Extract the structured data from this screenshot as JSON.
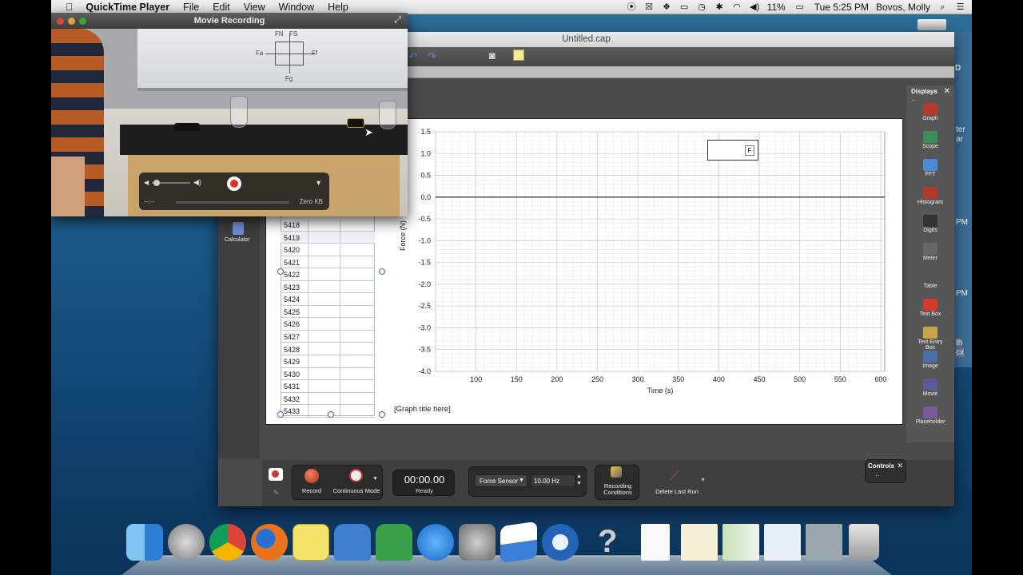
{
  "menubar": {
    "apple": "",
    "app_name": "QuickTime Player",
    "items": [
      "File",
      "Edit",
      "View",
      "Window",
      "Help"
    ],
    "battery": "11%",
    "clock": "Tue 5:25 PM",
    "user": "Bovos, Molly"
  },
  "quicktime": {
    "title": "Movie Recording",
    "elapsed": "--:--",
    "size": "Zero KB",
    "whiteboard": [
      "FN",
      "FS",
      "Fa",
      "Ff",
      "Fg"
    ]
  },
  "logger": {
    "window_title": "Untitled.cap",
    "calculator_label": "Calculator",
    "table_rows": [
      "5418",
      "5419",
      "5420",
      "5421",
      "5422",
      "5423",
      "5424",
      "5425",
      "5426",
      "5427",
      "5428",
      "5429",
      "5430",
      "5431",
      "5432",
      "5433"
    ],
    "graph_title": "[Graph title here]",
    "legend_label": "F",
    "displays": {
      "header": "Displays",
      "items": [
        "Graph",
        "Scope",
        "FFT",
        "Histogram",
        "Digits",
        "Meter",
        "Table",
        "Text Box",
        "Text Entry Box",
        "Image",
        "Movie",
        "Placeholder"
      ]
    },
    "controls": {
      "panel_label": "Controls",
      "record": "Record",
      "mode": "Continuous Mode",
      "time": "00:00.00",
      "status": "Ready",
      "sensor": "Force Sensor",
      "rate": "10.00 Hz",
      "conditions_line1": "Recording",
      "conditions_line2": "Conditions",
      "delete": "Delete Last Run"
    }
  },
  "desktop_fragments": [
    "ter",
    "ar",
    "PM",
    "PM",
    "PM",
    "th",
    "cx",
    "D"
  ],
  "chart_data": {
    "type": "line",
    "title": "[Graph title here]",
    "xlabel": "Time (s)",
    "ylabel": "Force (N)",
    "xlim": [
      50,
      605
    ],
    "ylim": [
      -4.0,
      1.5
    ],
    "xticks": [
      100,
      150,
      200,
      250,
      300,
      350,
      400,
      450,
      500,
      550,
      600
    ],
    "yticks": [
      1.5,
      1.0,
      0.5,
      0.0,
      -0.5,
      -1.0,
      -1.5,
      -2.0,
      -2.5,
      -3.0,
      -3.5,
      -4.0
    ],
    "ytick_labels": [
      "1.5",
      "1.0",
      "0.5",
      "0.0",
      "-0.5",
      "-1.0",
      "-1.5",
      "-2.0",
      "-2.5",
      "-3.0",
      "-3.5",
      "-4.0"
    ],
    "series": [
      {
        "name": "F",
        "x": [],
        "y": []
      }
    ],
    "grid": true,
    "legend": "top-right"
  }
}
